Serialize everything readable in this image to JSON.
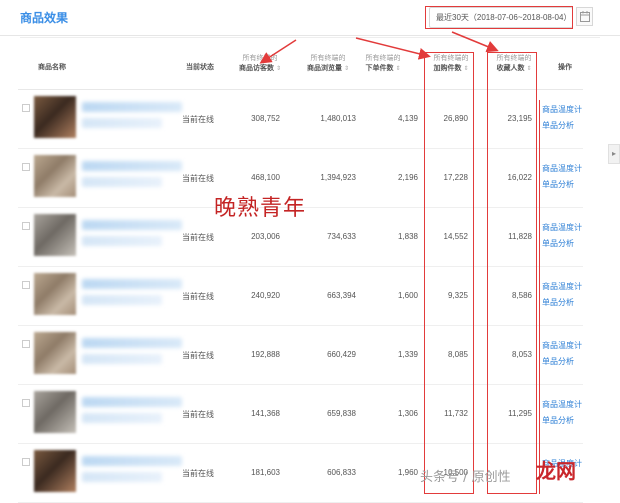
{
  "header": {
    "title": "商品效果",
    "date_range": "最近30天（2018-07-06~2018-08-04）"
  },
  "columns": [
    {
      "sub": "",
      "main": "商品名称"
    },
    {
      "sub": "",
      "main": "当前状态"
    },
    {
      "sub": "所有终端的",
      "main": "商品访客数"
    },
    {
      "sub": "所有终端的",
      "main": "商品浏览量"
    },
    {
      "sub": "所有终端的",
      "main": "下单件数"
    },
    {
      "sub": "所有终端的",
      "main": "加购件数"
    },
    {
      "sub": "所有终端的",
      "main": "收藏人数"
    },
    {
      "sub": "",
      "main": "操作"
    }
  ],
  "rows": [
    {
      "status": "当前在线",
      "visitors": "308,752",
      "pageviews": "1,480,013",
      "orders": "4,139",
      "cart": "26,890",
      "favorites": "23,195",
      "thumb": "dark"
    },
    {
      "status": "当前在线",
      "visitors": "468,100",
      "pageviews": "1,394,923",
      "orders": "2,196",
      "cart": "17,228",
      "favorites": "16,022",
      "thumb": "normal"
    },
    {
      "status": "当前在线",
      "visitors": "203,006",
      "pageviews": "734,633",
      "orders": "1,838",
      "cart": "14,552",
      "favorites": "11,828",
      "thumb": "gray"
    },
    {
      "status": "当前在线",
      "visitors": "240,920",
      "pageviews": "663,394",
      "orders": "1,600",
      "cart": "9,325",
      "favorites": "8,586",
      "thumb": "normal"
    },
    {
      "status": "当前在线",
      "visitors": "192,888",
      "pageviews": "660,429",
      "orders": "1,339",
      "cart": "8,085",
      "favorites": "8,053",
      "thumb": "normal"
    },
    {
      "status": "当前在线",
      "visitors": "141,368",
      "pageviews": "659,838",
      "orders": "1,306",
      "cart": "11,732",
      "favorites": "11,295",
      "thumb": "gray"
    },
    {
      "status": "当前在线",
      "visitors": "181,603",
      "pageviews": "606,833",
      "orders": "1,960",
      "cart": "10,500",
      "favorites": "",
      "thumb": "dark"
    }
  ],
  "actions": {
    "temperature": "商品温度计",
    "analysis": "单品分析"
  },
  "annotation_text": "晚熟青年",
  "footer_watermark": "头条号 / 原创性",
  "logo_text": "龙网",
  "colors": {
    "accent": "#3a8ee6",
    "link": "#2f80d6",
    "annotation": "#e23b3b"
  }
}
